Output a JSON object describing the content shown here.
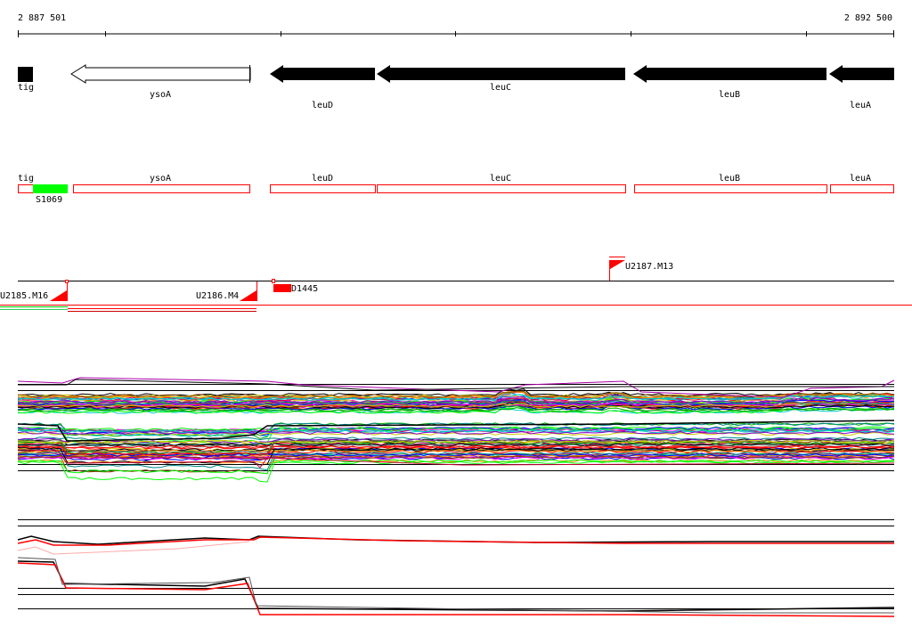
{
  "coordinates": {
    "start_label": "2 887 501",
    "end_label": "2 892 500"
  },
  "genes_track": [
    {
      "name": "tig",
      "strand": "-",
      "fill": "#000000"
    },
    {
      "name": "ysoA",
      "strand": "-",
      "fill": "#ffffff"
    },
    {
      "name": "leuD",
      "strand": "-",
      "fill": "#000000"
    },
    {
      "name": "leuC",
      "strand": "-",
      "fill": "#000000"
    },
    {
      "name": "leuB",
      "strand": "-",
      "fill": "#000000"
    },
    {
      "name": "leuA",
      "strand": "-",
      "fill": "#000000"
    }
  ],
  "boxes_track": [
    {
      "name": "tig"
    },
    {
      "name": "ysoA"
    },
    {
      "name": "leuD"
    },
    {
      "name": "leuC"
    },
    {
      "name": "leuB"
    },
    {
      "name": "leuA"
    }
  ],
  "box_feature": {
    "name": "S1069",
    "color": "#00ff00"
  },
  "markers": [
    {
      "name": "U2187.M13"
    },
    {
      "name": "U2185.M16"
    },
    {
      "name": "U2186.M4"
    },
    {
      "name": "D1445"
    }
  ],
  "colors": {
    "feature_red": "#ff0000",
    "box_green": "#00ff00",
    "axis": "#000000"
  }
}
